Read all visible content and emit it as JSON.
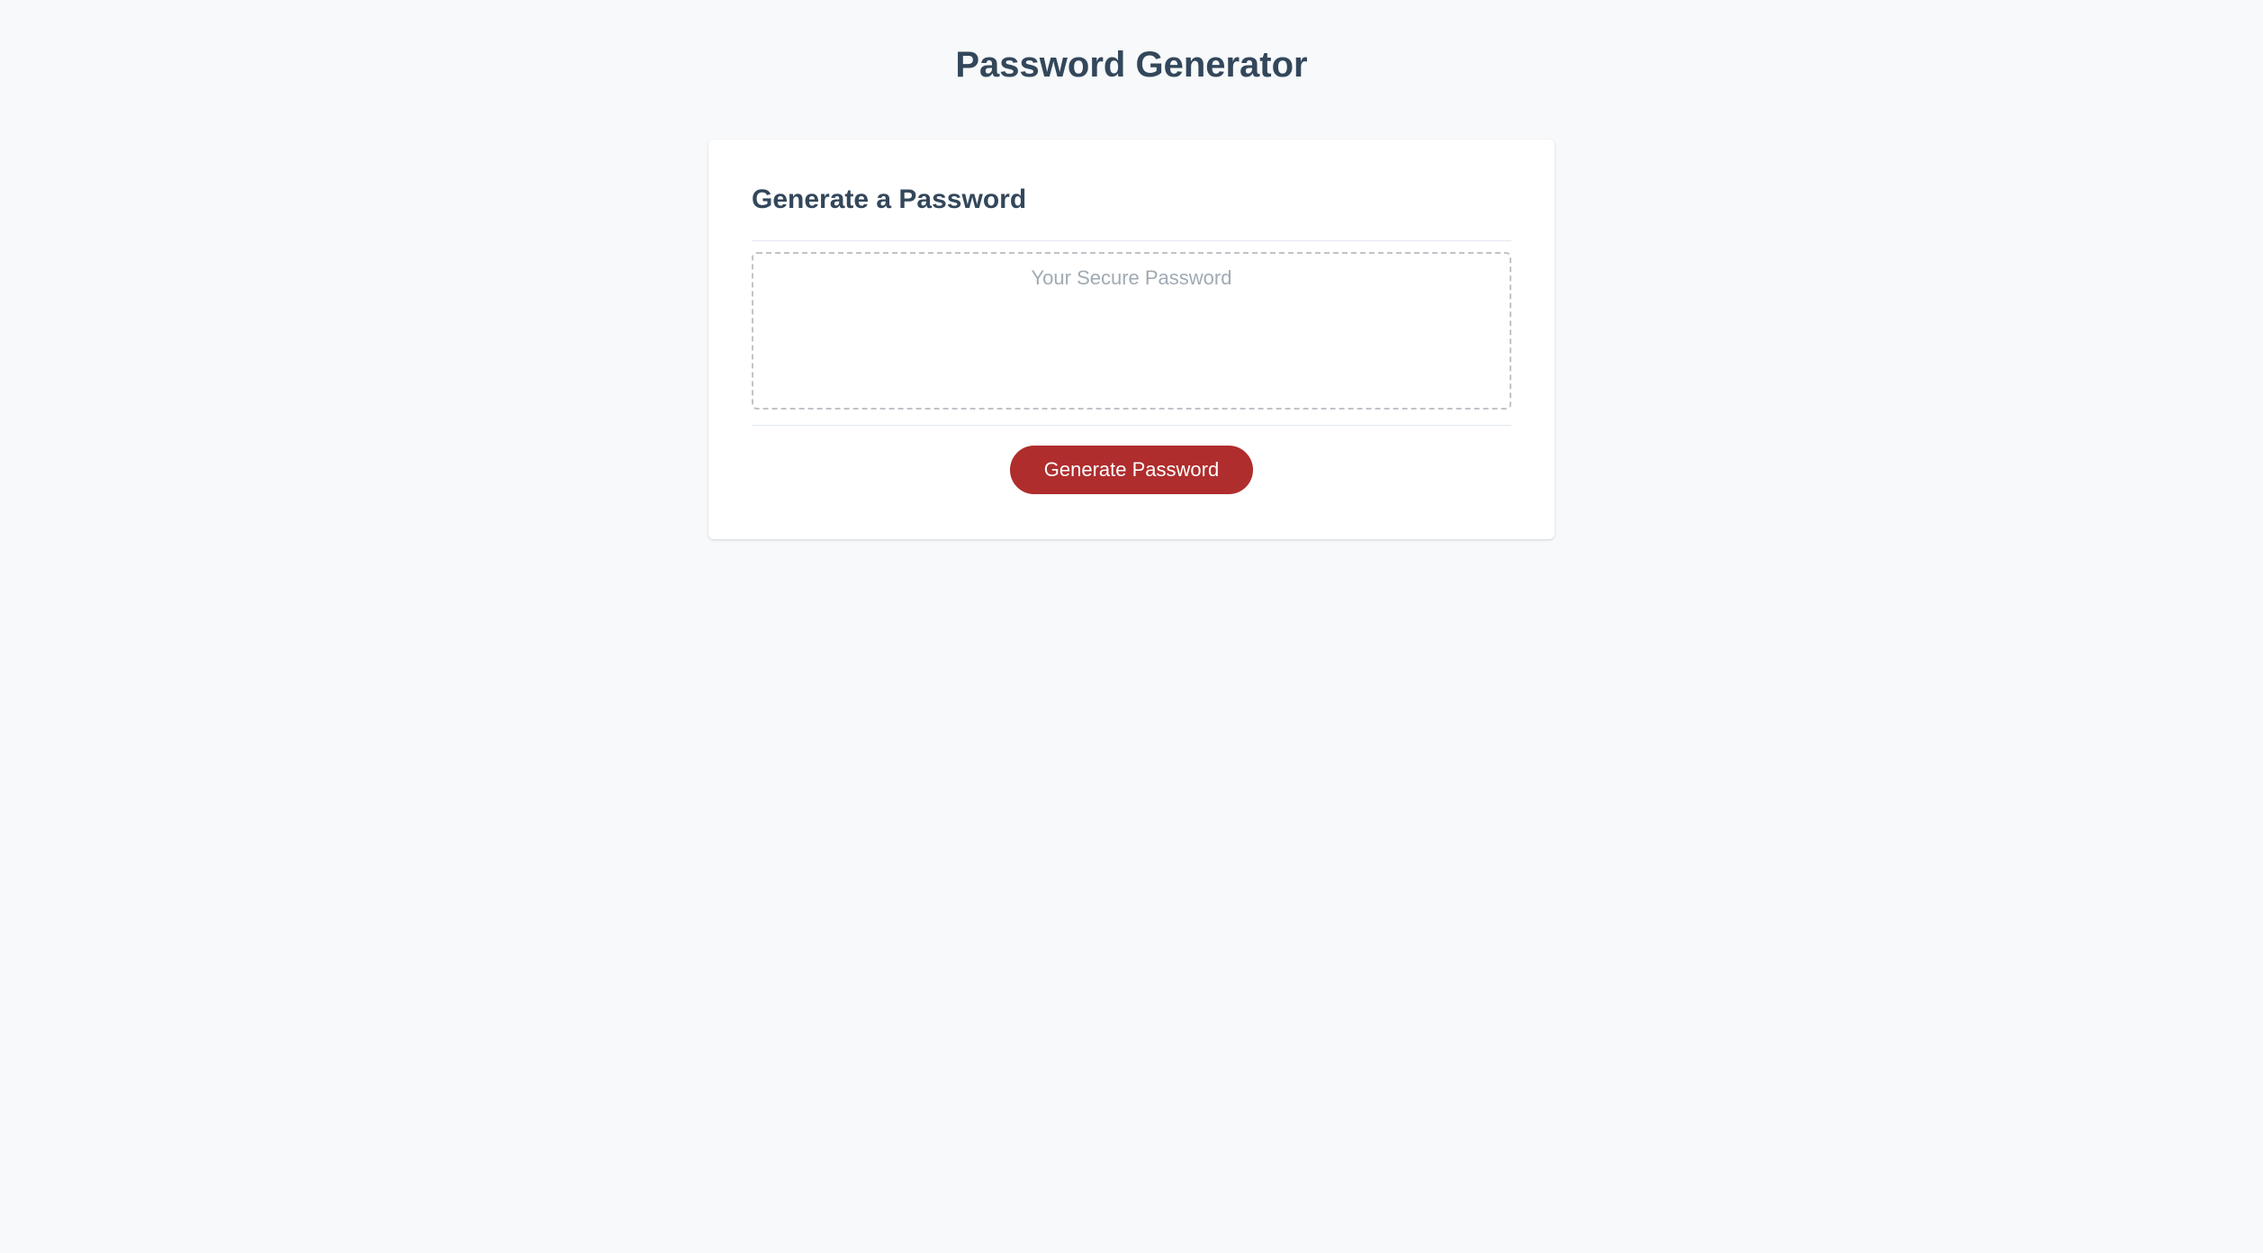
{
  "page": {
    "title": "Password Generator"
  },
  "card": {
    "heading": "Generate a Password",
    "output_placeholder": "Your Secure Password",
    "output_value": "",
    "generate_button_label": "Generate Password"
  }
}
